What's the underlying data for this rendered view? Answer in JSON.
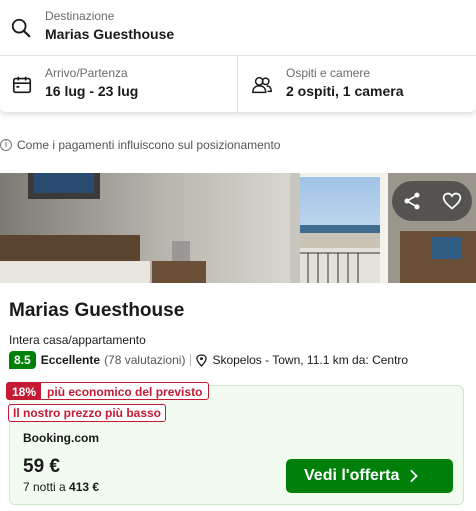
{
  "search": {
    "destination_label": "Destinazione",
    "destination_value": "Marias Guesthouse",
    "dates_label": "Arrivo/Partenza",
    "dates_value": "16 lug - 23 lug",
    "guests_label": "Ospiti e camere",
    "guests_value": "2 ospiti, 1 camera"
  },
  "info": {
    "text": "Come i pagamenti influiscono sul posizionamento",
    "icon": "info-icon"
  },
  "hotel": {
    "name": "Marias Guesthouse",
    "type": "Intera casa/appartamento",
    "score": "8.5",
    "rating_word": "Eccellente",
    "rating_count": "(78 valutazioni)",
    "location": "Skopelos - Town, 11.1 km da: Centro"
  },
  "deal": {
    "discount_pct": "18%",
    "discount_text": "più economico del previsto",
    "lowest_price_badge": "Il nostro prezzo più basso",
    "provider": "Booking.com",
    "price": "59 €",
    "nights_prefix": "7 notti a",
    "total": "413 €",
    "cta_label": "Vedi l'offerta"
  },
  "colors": {
    "score_green": "#008009",
    "cta_green": "#00800a",
    "badge_red": "#c41a36",
    "deal_bg": "#f1fbf0"
  }
}
